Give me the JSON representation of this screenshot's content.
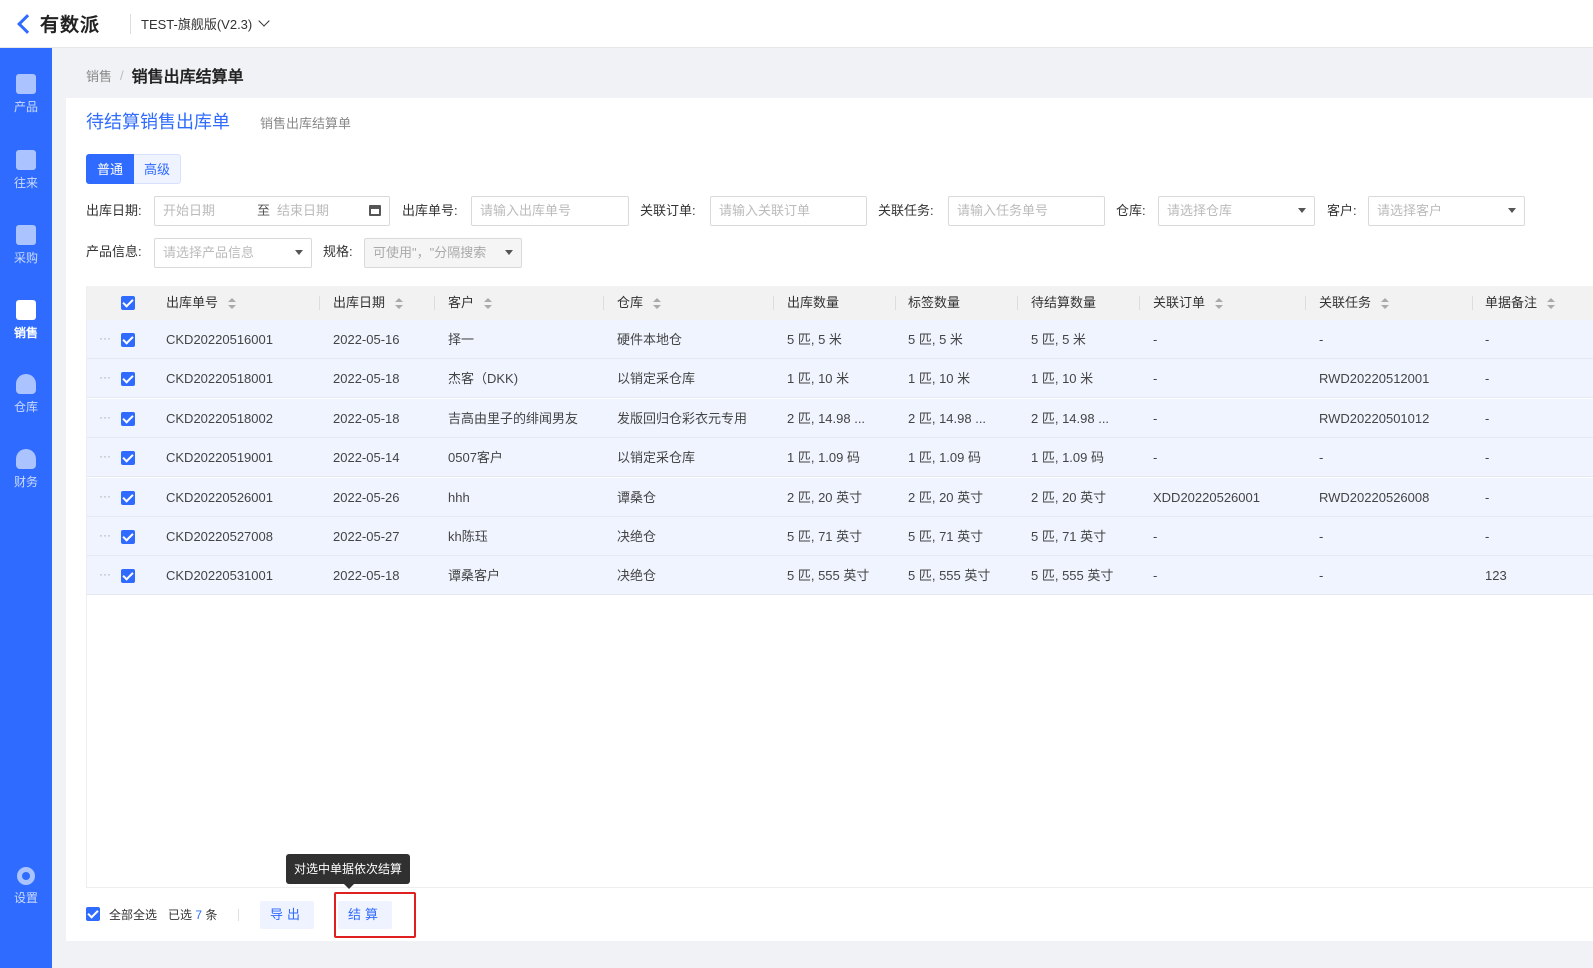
{
  "app": {
    "logo_text": "有数派",
    "version": "TEST-旗舰版(V2.3)"
  },
  "sidebar": {
    "items": [
      {
        "label": "产品",
        "icon": "box-icon"
      },
      {
        "label": "往来",
        "icon": "contact-icon"
      },
      {
        "label": "采购",
        "icon": "purchase-icon"
      },
      {
        "label": "销售",
        "icon": "clipboard-icon",
        "active": true
      },
      {
        "label": "仓库",
        "icon": "warehouse-icon"
      },
      {
        "label": "财务",
        "icon": "money-bag-icon"
      }
    ],
    "settings_label": "设置"
  },
  "breadcrumb": {
    "parent": "销售",
    "separator": "/",
    "current": "销售出库结算单"
  },
  "page": {
    "title": "待结算销售出库单",
    "subtab": "销售出库结算单"
  },
  "search_mode": {
    "normal": "普通",
    "advanced": "高级"
  },
  "filters": {
    "out_date_label": "出库日期:",
    "start_placeholder": "开始日期",
    "to": "至",
    "end_placeholder": "结束日期",
    "out_no_label": "出库单号:",
    "out_no_placeholder": "请输入出库单号",
    "order_label": "关联订单:",
    "order_placeholder": "请输入关联订单",
    "task_label": "关联任务:",
    "task_placeholder": "请输入任务单号",
    "warehouse_label": "仓库:",
    "warehouse_placeholder": "请选择仓库",
    "customer_label": "客户:",
    "customer_placeholder": "请选择客户",
    "product_label": "产品信息:",
    "product_placeholder": "请选择产品信息",
    "spec_label": "规格:",
    "spec_placeholder": "可使用\"，\"分隔搜索"
  },
  "table": {
    "columns": [
      "出库单号",
      "出库日期",
      "客户",
      "仓库",
      "出库数量",
      "标签数量",
      "待结算数量",
      "关联订单",
      "关联任务",
      "单据备注"
    ],
    "rows": [
      [
        "CKD20220516001",
        "2022-05-16",
        "择一",
        "硬件本地仓",
        "5 匹, 5 米",
        "5 匹, 5 米",
        "5 匹, 5 米",
        "-",
        "-",
        "-"
      ],
      [
        "CKD20220518001",
        "2022-05-18",
        "杰客（DKK)",
        "以销定采仓库",
        "1 匹, 10 米",
        "1 匹, 10 米",
        "1 匹, 10 米",
        "-",
        "RWD20220512001",
        "-"
      ],
      [
        "CKD20220518002",
        "2022-05-18",
        "吉高由里子的绯闻男友",
        "发版回归仓彩衣元专用",
        "2 匹, 14.98 ...",
        "2 匹, 14.98 ...",
        "2 匹, 14.98 ...",
        "-",
        "RWD20220501012",
        "-"
      ],
      [
        "CKD20220519001",
        "2022-05-14",
        "0507客户",
        "以销定采仓库",
        "1 匹, 1.09 码",
        "1 匹, 1.09 码",
        "1 匹, 1.09 码",
        "-",
        "-",
        "-"
      ],
      [
        "CKD20220526001",
        "2022-05-26",
        "hhh",
        "谭桑仓",
        "2 匹, 20 英寸",
        "2 匹, 20 英寸",
        "2 匹, 20 英寸",
        "XDD20220526001",
        "RWD20220526008",
        "-"
      ],
      [
        "CKD20220527008",
        "2022-05-27",
        "kh陈珏",
        "决绝仓",
        "5 匹, 71 英寸",
        "5 匹, 71 英寸",
        "5 匹, 71 英寸",
        "-",
        "-",
        "-"
      ],
      [
        "CKD20220531001",
        "2022-05-18",
        "谭桑客户",
        "决绝仓",
        "5 匹, 555 英寸",
        "5 匹, 555 英寸",
        "5 匹, 555 英寸",
        "-",
        "-",
        "123"
      ]
    ],
    "row_menu_glyph": "···"
  },
  "footer": {
    "select_all": "全部全选",
    "selected_prefix": "已选",
    "selected_count": "7",
    "selected_suffix": "条",
    "export_label": "导出",
    "settle_label": "结算"
  },
  "tooltip": {
    "text": "对选中单据依次结算"
  },
  "colors": {
    "primary": "#2f6bff",
    "row_selected": "#f0f4ff",
    "highlight_border": "#e02020"
  }
}
